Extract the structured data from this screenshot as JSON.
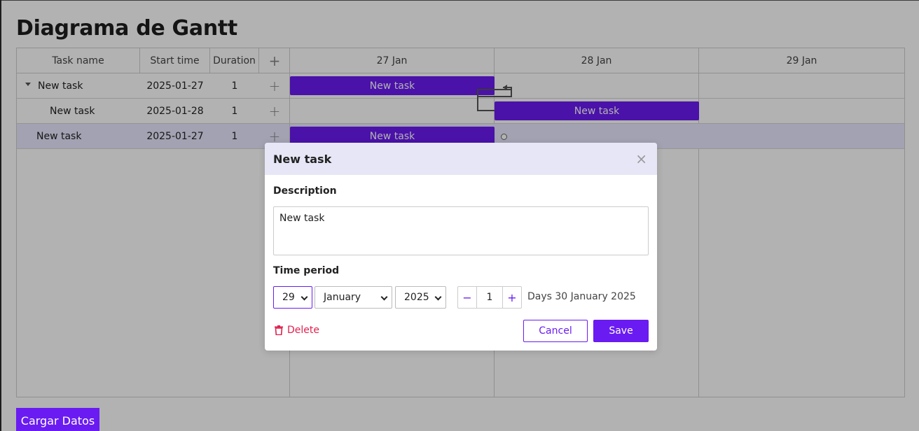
{
  "page": {
    "title": "Diagrama de Gantt",
    "load_button": "Cargar Datos"
  },
  "grid": {
    "columns": [
      "Task name",
      "Start time",
      "Duration",
      "+"
    ],
    "rows": [
      {
        "name": "New task",
        "start": "2025-01-27",
        "duration": "1",
        "add": "+"
      },
      {
        "name": "New task",
        "start": "2025-01-28",
        "duration": "1",
        "add": "+"
      },
      {
        "name": "New task",
        "start": "2025-01-27",
        "duration": "1",
        "add": "+"
      }
    ]
  },
  "timeline": {
    "days": [
      "27 Jan",
      "28 Jan",
      "29 Jan"
    ],
    "bars": [
      "New task",
      "New task",
      "New task"
    ]
  },
  "modal": {
    "title": "New task",
    "close": "×",
    "description_label": "Description",
    "description_value": "New task",
    "period_label": "Time period",
    "day": "29",
    "month": "January",
    "year": "2025",
    "minus": "−",
    "duration": "1",
    "plus": "+",
    "days_text": "Days 30 January 2025",
    "delete": "Delete",
    "cancel": "Cancel",
    "save": "Save"
  },
  "colors": {
    "accent": "#6a1bf2",
    "danger": "#e0204d",
    "header": "#e6e6f7"
  }
}
